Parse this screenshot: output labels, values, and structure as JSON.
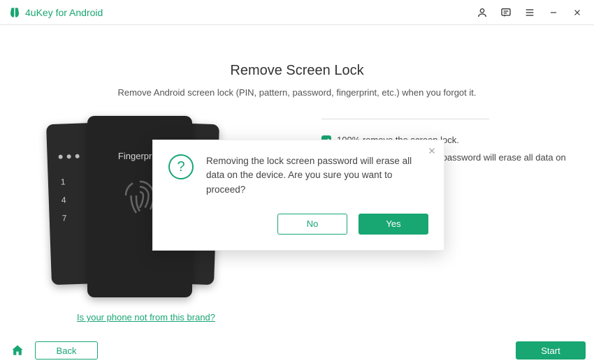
{
  "titlebar": {
    "app_name": "4uKey for Android"
  },
  "main": {
    "heading": "Remove Screen Lock",
    "subhead": "Remove Android screen lock (PIN, pattern, password, fingerprint, etc.) when you forgot it.",
    "phone": {
      "fp_label": "Fingerprint",
      "pad_numbers": [
        "1",
        "4",
        "7"
      ]
    },
    "features": [
      "100% remove the screen lock.",
      "Removing the lock screen password will erase all data on your device."
    ],
    "brand_link": "Is your phone not from this brand?"
  },
  "modal": {
    "message": "Removing the lock screen password will erase all data on the device. Are you sure you want to proceed?",
    "no_label": "No",
    "yes_label": "Yes"
  },
  "footer": {
    "back_label": "Back",
    "start_label": "Start"
  }
}
